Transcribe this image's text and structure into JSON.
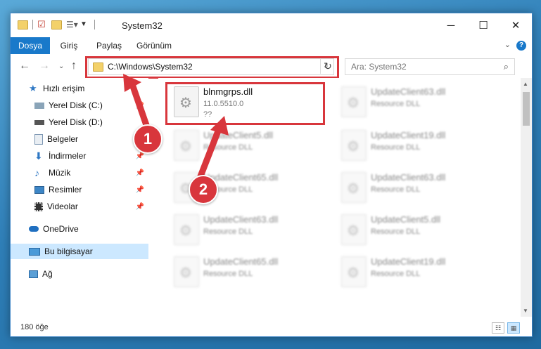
{
  "window": {
    "title": "System32",
    "controls": {
      "minimize": "─",
      "maximize": "☐",
      "close": "✕"
    }
  },
  "ribbon": {
    "tabs": [
      "Dosya",
      "Giriş",
      "Paylaş",
      "Görünüm"
    ],
    "help": "?"
  },
  "address": {
    "path": "C:\\Windows\\System32",
    "search_placeholder": "Ara: System32"
  },
  "sidebar": {
    "items": [
      {
        "label": "Hızlı erişim",
        "icon": "star-icon"
      },
      {
        "label": "Yerel Disk (C:)",
        "icon": "drive-icon",
        "pinned": true
      },
      {
        "label": "Yerel Disk (D:)",
        "icon": "drive-icon",
        "pinned": true
      },
      {
        "label": "Belgeler",
        "icon": "documents-icon",
        "pinned": true
      },
      {
        "label": "İndirmeler",
        "icon": "downloads-icon",
        "pinned": true
      },
      {
        "label": "Müzik",
        "icon": "music-icon",
        "pinned": true
      },
      {
        "label": "Resimler",
        "icon": "pictures-icon",
        "pinned": true
      },
      {
        "label": "Videolar",
        "icon": "videos-icon",
        "pinned": true
      },
      {
        "label": "OneDrive",
        "icon": "cloud-icon"
      },
      {
        "label": "Bu bilgisayar",
        "icon": "computer-icon",
        "selected": true
      },
      {
        "label": "Ağ",
        "icon": "network-icon"
      }
    ]
  },
  "files": [
    {
      "name": "blnmgrps.dll",
      "line1": "11.0.5510.0",
      "line2": "??",
      "highlighted": true
    },
    {
      "name": "UpdateClient63.dll",
      "line1": "Resource DLL"
    },
    {
      "name": "UpdateClient5.dll",
      "line1": "Resource DLL"
    },
    {
      "name": "UpdateClient19.dll",
      "line1": "Resource DLL"
    },
    {
      "name": "UpdateClient65.dll",
      "line1": "Resource DLL"
    },
    {
      "name": "UpdateClient63.dll",
      "line1": "Resource DLL"
    },
    {
      "name": "UpdateClient63.dll",
      "line1": "Resource DLL"
    },
    {
      "name": "UpdateClient5.dll",
      "line1": "Resource DLL"
    },
    {
      "name": "UpdateClient65.dll",
      "line1": "Resource DLL"
    },
    {
      "name": "UpdateClient19.dll",
      "line1": "Resource DLL"
    }
  ],
  "status": {
    "count": "180 öğe"
  },
  "annotations": {
    "step1": "1",
    "step2": "2",
    "color": "#d8363c"
  }
}
